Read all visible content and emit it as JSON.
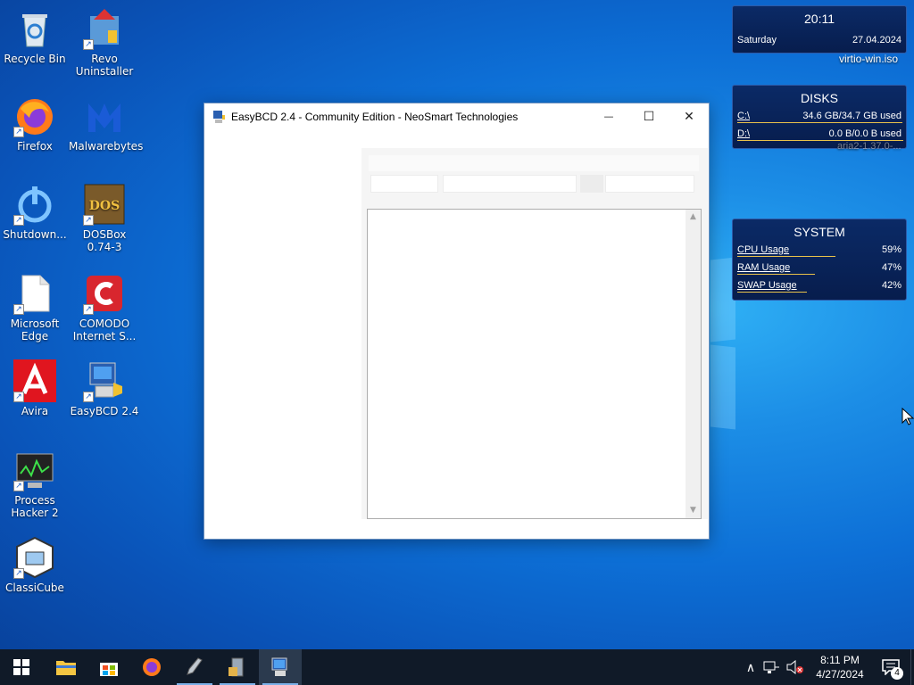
{
  "desktop_icons": [
    {
      "label": "Recycle Bin",
      "icon": "recycle-bin-icon"
    },
    {
      "label": "Revo Uninstaller",
      "icon": "revo-uninstaller-icon"
    },
    {
      "label": "Firefox",
      "icon": "firefox-icon"
    },
    {
      "label": "Malwarebytes",
      "icon": "malwarebytes-icon"
    },
    {
      "label": "Shutdown...",
      "icon": "shutdown-icon"
    },
    {
      "label": "DOSBox 0.74-3",
      "icon": "dosbox-icon"
    },
    {
      "label": "Microsoft Edge",
      "icon": "edge-file-icon"
    },
    {
      "label": "COMODO Internet S...",
      "icon": "comodo-icon"
    },
    {
      "label": "Avira",
      "icon": "avira-icon"
    },
    {
      "label": "EasyBCD 2.4",
      "icon": "easybcd-icon"
    },
    {
      "label": "Process Hacker 2",
      "icon": "process-hacker-icon"
    },
    {
      "label": "ClassiCube",
      "icon": "classicube-icon"
    }
  ],
  "window": {
    "title": "EasyBCD 2.4 - Community Edition - NeoSmart Technologies",
    "minimize_glyph": "—",
    "maximize_glyph": "☐",
    "close_glyph": "✕",
    "scroll_up_glyph": "▲",
    "scroll_down_glyph": "▼"
  },
  "gadgets": {
    "clock": {
      "time": "20:11",
      "day": "Saturday",
      "date": "27.04.2024"
    },
    "disks": {
      "title": "DISKS",
      "drives": [
        {
          "label": "C:\\",
          "value": "34.6 GB/34.7 GB used",
          "fill_fraction": 0.997
        },
        {
          "label": "D:\\",
          "value": "0.0 B/0.0 B used",
          "fill_fraction": 1.0
        }
      ]
    },
    "system": {
      "title": "SYSTEM",
      "rows": [
        {
          "label": "CPU Usage",
          "value": "59%",
          "fill_fraction": 0.59
        },
        {
          "label": "RAM Usage",
          "value": "47%",
          "fill_fraction": 0.47
        },
        {
          "label": "SWAP Usage",
          "value": "42%",
          "fill_fraction": 0.42
        }
      ]
    }
  },
  "desktop_files": [
    {
      "label": "virtio-win.iso"
    },
    {
      "label": "aria2-1.37.0-..."
    }
  ],
  "taskbar": {
    "items": [
      "start-icon",
      "file-explorer-icon",
      "store-icon",
      "firefox-icon",
      "rocket-app-icon",
      "server-app-icon",
      "easybcd-icon"
    ],
    "clock_time": "8:11 PM",
    "clock_date": "4/27/2024",
    "notification_count": "4",
    "chevron_glyph": "∧"
  },
  "colors": {
    "accent_bar": "#e8c24a",
    "taskbar_bg": "#101a28",
    "gadget_bg": "#0b2a66"
  }
}
